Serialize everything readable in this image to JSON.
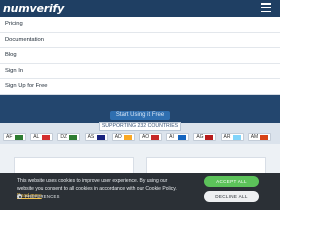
{
  "header": {
    "logo": "numverify"
  },
  "menu": {
    "items": [
      {
        "label": "Pricing"
      },
      {
        "label": "Documentation"
      },
      {
        "label": "Blog"
      },
      {
        "label": "Sign In"
      },
      {
        "label": "Sign Up for Free"
      }
    ]
  },
  "hero": {
    "cta_label": "Start Using it Free"
  },
  "countries": {
    "label": "SUPPORTING 232 COUNTRIES",
    "flags": [
      {
        "code": "AF",
        "color": "#2e7d32"
      },
      {
        "code": "AL",
        "color": "#d32f2f"
      },
      {
        "code": "DZ",
        "color": "#2e7d32"
      },
      {
        "code": "AS",
        "color": "#1a237e"
      },
      {
        "code": "AD",
        "color": "#f9a825"
      },
      {
        "code": "AO",
        "color": "#c62828"
      },
      {
        "code": "AI",
        "color": "#1565c0"
      },
      {
        "code": "AG",
        "color": "#b71c1c"
      },
      {
        "code": "AR",
        "color": "#81d4fa"
      },
      {
        "code": "AM",
        "color": "#d84315"
      }
    ]
  },
  "cookie": {
    "text": "This website uses cookies to improve user experience. By using our website you consent to all cookies in accordance with our Cookie Policy.",
    "link": "Read more",
    "preferences": "PREFERENCES",
    "accept": "ACCEPT ALL",
    "decline": "DECLINE ALL"
  },
  "colors": {
    "header": "#1f3f63",
    "accept": "#5cc25a",
    "banner": "#2b3036"
  }
}
